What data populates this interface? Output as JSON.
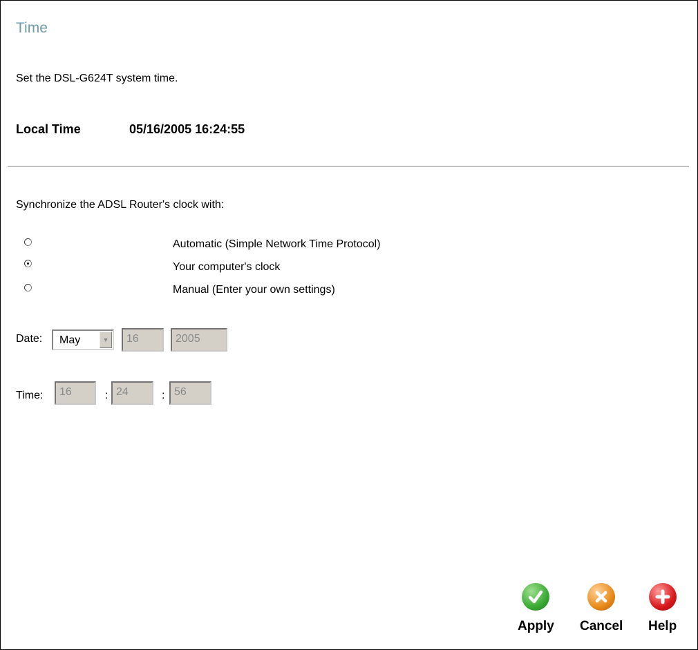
{
  "page": {
    "title": "Time",
    "description": "Set the DSL-G624T system time.",
    "local_time_label": "Local Time",
    "local_time_value": "05/16/2005 16:24:55"
  },
  "sync": {
    "heading": "Synchronize the ADSL Router's clock with:",
    "options": [
      {
        "label": "Automatic (Simple Network Time Protocol)",
        "checked": false
      },
      {
        "label": "Your computer's clock",
        "checked": true
      },
      {
        "label": "Manual (Enter your own settings)",
        "checked": false
      }
    ]
  },
  "date": {
    "label": "Date:",
    "month": "May",
    "day": "16",
    "year": "2005"
  },
  "time": {
    "label": "Time:",
    "hour": "16",
    "minute": "24",
    "second": "56",
    "separator": ":"
  },
  "actions": {
    "apply": "Apply",
    "cancel": "Cancel",
    "help": "Help"
  },
  "colors": {
    "title": "#6f9aa6",
    "apply": "#3aaa35",
    "cancel": "#e88a1a",
    "help": "#d7191c"
  }
}
